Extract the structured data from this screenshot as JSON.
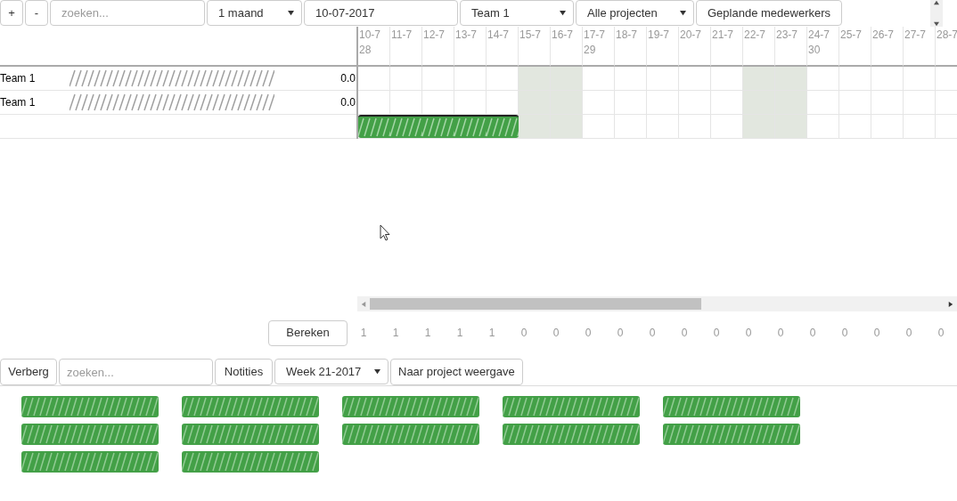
{
  "toolbar": {
    "zoom_in": "+",
    "zoom_out": "-",
    "search": {
      "placeholder": "zoeken..."
    },
    "period": "1 maand",
    "date": "10-07-2017",
    "team": "Team 1",
    "projects": "Alle projecten",
    "planned_button": "Geplande medewerkers"
  },
  "days": [
    {
      "date": "10-7",
      "week": "28",
      "weekend": false,
      "total": "1"
    },
    {
      "date": "11-7",
      "weekend": false,
      "total": "1"
    },
    {
      "date": "12-7",
      "weekend": false,
      "total": "1"
    },
    {
      "date": "13-7",
      "weekend": false,
      "total": "1"
    },
    {
      "date": "14-7",
      "weekend": false,
      "total": "1"
    },
    {
      "date": "15-7",
      "weekend": true,
      "total": "0"
    },
    {
      "date": "16-7",
      "weekend": true,
      "total": "0"
    },
    {
      "date": "17-7",
      "week": "29",
      "weekend": false,
      "total": "0"
    },
    {
      "date": "18-7",
      "weekend": false,
      "total": "0"
    },
    {
      "date": "19-7",
      "weekend": false,
      "total": "0"
    },
    {
      "date": "20-7",
      "weekend": false,
      "total": "0"
    },
    {
      "date": "21-7",
      "weekend": false,
      "total": "0"
    },
    {
      "date": "22-7",
      "weekend": true,
      "total": "0"
    },
    {
      "date": "23-7",
      "weekend": true,
      "total": "0"
    },
    {
      "date": "24-7",
      "week": "30",
      "weekend": false,
      "total": "0"
    },
    {
      "date": "25-7",
      "weekend": false,
      "total": "0"
    },
    {
      "date": "26-7",
      "weekend": false,
      "total": "0"
    },
    {
      "date": "27-7",
      "weekend": false,
      "total": "0"
    },
    {
      "date": "28-7",
      "weekend": false,
      "total": "0"
    }
  ],
  "rows": [
    {
      "kind": "employee",
      "team": "Team 1",
      "value": "0.0"
    },
    {
      "kind": "employee",
      "team": "Team 1",
      "value": "0.0"
    },
    {
      "kind": "bar",
      "booked": [
        true,
        true,
        true,
        true,
        true,
        false,
        false,
        false,
        false,
        false,
        false,
        false,
        false,
        false,
        false,
        false,
        false,
        false,
        false
      ]
    }
  ],
  "calculate_button": "Bereken",
  "bottom_toolbar": {
    "hide_button": "Verberg",
    "search": {
      "placeholder": "zoeken..."
    },
    "notes_button": "Notities",
    "week": "Week 21-2017",
    "project_view_button": "Naar project weergave"
  },
  "projects": [
    {
      "kind": "chip"
    },
    {
      "kind": "chip"
    },
    {
      "kind": "chip"
    },
    {
      "kind": "chip"
    },
    {
      "kind": "chip"
    },
    {
      "kind": "chip"
    },
    {
      "kind": "chip"
    },
    {
      "kind": "chip"
    },
    {
      "kind": "chip"
    },
    {
      "kind": "chip"
    },
    {
      "kind": "chip"
    },
    {
      "kind": "chip"
    }
  ]
}
